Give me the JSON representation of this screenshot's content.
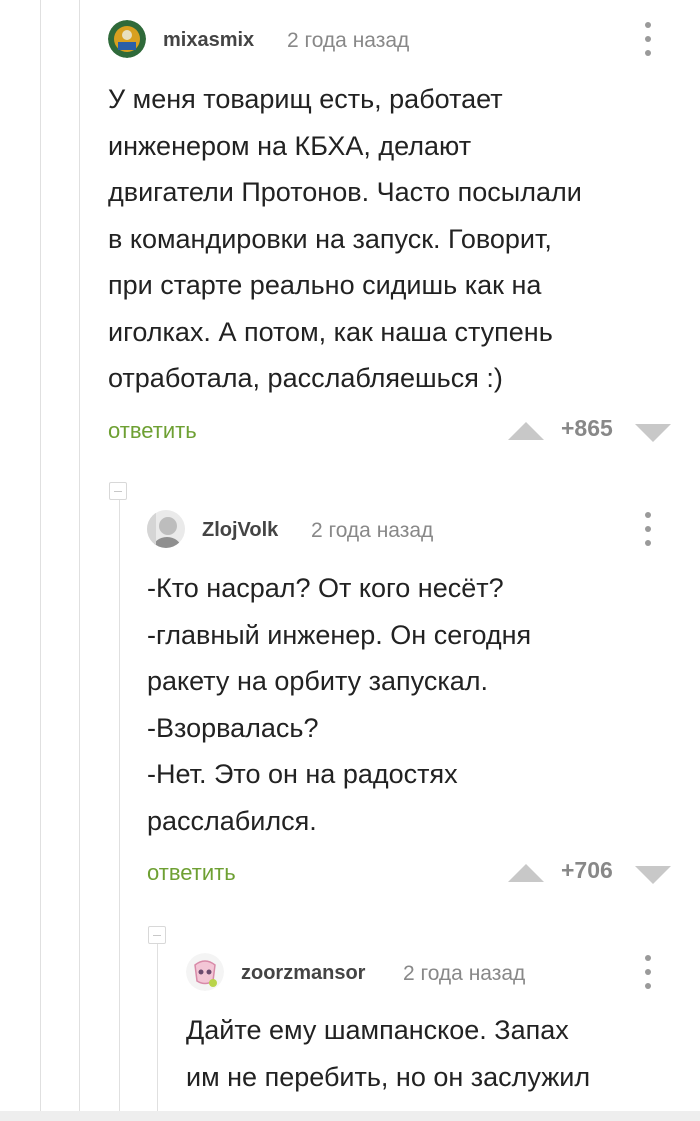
{
  "comments": [
    {
      "author": "mixasmix",
      "time": "2 года назад",
      "lines": [
        "У меня товарищ есть, работает",
        "инженером на КБХА, делают",
        "двигатели Протонов. Часто посылали",
        "в командировки на запуск. Говорит,",
        "при старте реально сидишь как на",
        "иголках. А потом, как наша ступень",
        "отработала, расслабляешься :)"
      ],
      "reply_label": "ответить",
      "rating": "+865"
    },
    {
      "author": "ZlojVolk",
      "time": "2 года назад",
      "lines": [
        "-Кто насрал? От кого несёт?",
        "-главный инженер. Он сегодня",
        "ракету на орбиту запускал.",
        "-Взорвалась?",
        "-Нет. Это он на радостях",
        "расслабился."
      ],
      "reply_label": "ответить",
      "rating": "+706"
    },
    {
      "author": "zoorzmansor",
      "time": "2 года назад",
      "lines": [
        "Дайте ему шампанское. Запах",
        "им не перебить, но он заслужил"
      ]
    }
  ],
  "colors": {
    "reply": "#6ea033",
    "muted": "#888888",
    "thread_line": "#e0e0e0"
  },
  "icons": {
    "menu": "more-vertical-icon",
    "vote_up": "triangle-up-icon",
    "vote_down": "triangle-down-icon",
    "collapse": "collapse-minus-icon"
  }
}
